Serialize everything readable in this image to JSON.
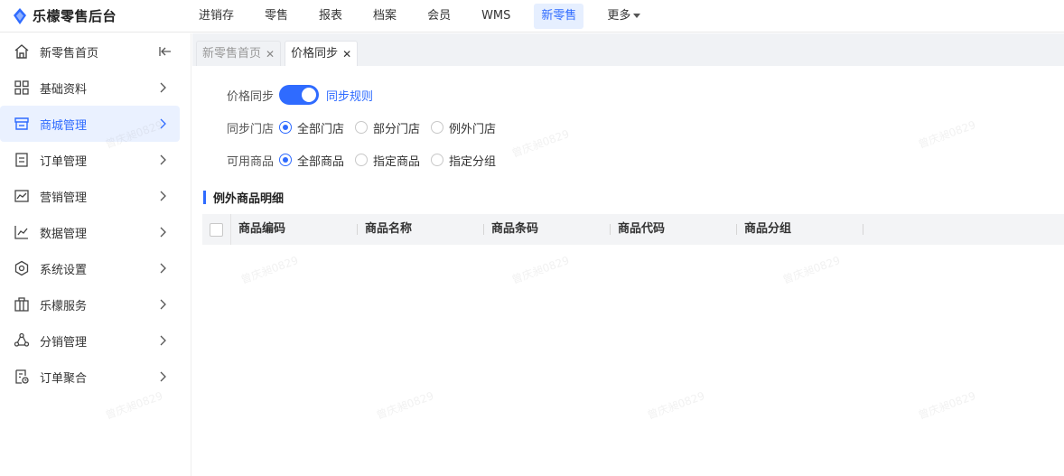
{
  "app": {
    "title": "乐檬零售后台"
  },
  "topnav": {
    "items": [
      "进销存",
      "零售",
      "报表",
      "档案",
      "会员",
      "WMS",
      "新零售",
      "更多"
    ],
    "active": "新零售"
  },
  "sidebar": {
    "items": [
      {
        "label": "新零售首页",
        "icon": "home-icon"
      },
      {
        "label": "基础资料",
        "icon": "grid-icon"
      },
      {
        "label": "商城管理",
        "icon": "store-icon"
      },
      {
        "label": "订单管理",
        "icon": "order-icon"
      },
      {
        "label": "营销管理",
        "icon": "marketing-icon"
      },
      {
        "label": "数据管理",
        "icon": "chart-icon"
      },
      {
        "label": "系统设置",
        "icon": "settings-icon"
      },
      {
        "label": "乐檬服务",
        "icon": "service-icon"
      },
      {
        "label": "分销管理",
        "icon": "distribution-icon"
      },
      {
        "label": "订单聚合",
        "icon": "aggregate-icon"
      }
    ],
    "active_index": 2
  },
  "tabs": [
    {
      "label": "新零售首页",
      "active": false
    },
    {
      "label": "价格同步",
      "active": true
    }
  ],
  "form": {
    "price_sync_label": "价格同步",
    "price_sync_enabled": true,
    "sync_rule_link": "同步规则",
    "store_label": "同步门店",
    "store_options": [
      "全部门店",
      "部分门店",
      "例外门店"
    ],
    "store_selected": 0,
    "product_label": "可用商品",
    "product_options": [
      "全部商品",
      "指定商品",
      "指定分组"
    ],
    "product_selected": 0
  },
  "section": {
    "title": "例外商品明细"
  },
  "table": {
    "columns": [
      "商品编码",
      "商品名称",
      "商品条码",
      "商品代码",
      "商品分组"
    ]
  },
  "watermark_text": "曾庆昶0829",
  "colors": {
    "accent": "#2f6bff",
    "active_bg": "#eaf1ff"
  }
}
